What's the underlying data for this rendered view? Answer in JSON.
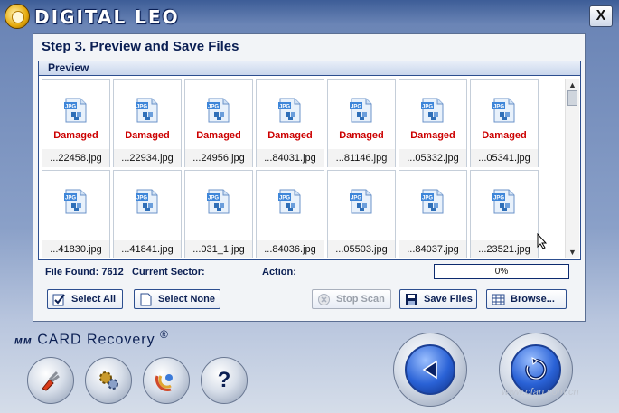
{
  "app": {
    "brand": "DIGITAL LEO",
    "close_label": "X"
  },
  "dialog": {
    "step_title": "Step 3. Preview and Save Files",
    "preview_label": "Preview",
    "tiles": [
      {
        "status": "Damaged",
        "name": "...22458.jpg"
      },
      {
        "status": "Damaged",
        "name": "...22934.jpg"
      },
      {
        "status": "Damaged",
        "name": "...24956.jpg"
      },
      {
        "status": "Damaged",
        "name": "...84031.jpg"
      },
      {
        "status": "Damaged",
        "name": "...81146.jpg"
      },
      {
        "status": "Damaged",
        "name": "...05332.jpg"
      },
      {
        "status": "Damaged",
        "name": "...05341.jpg"
      },
      {
        "status": "",
        "name": "...41830.jpg"
      },
      {
        "status": "",
        "name": "...41841.jpg"
      },
      {
        "status": "",
        "name": "...031_1.jpg"
      },
      {
        "status": "",
        "name": "...84036.jpg"
      },
      {
        "status": "",
        "name": "...05503.jpg"
      },
      {
        "status": "",
        "name": "...84037.jpg"
      },
      {
        "status": "",
        "name": "...23521.jpg"
      }
    ],
    "file_icon_label": "JPG",
    "status": {
      "file_found_label": "File Found: 7612",
      "current_sector_label": "Current Sector:",
      "action_label": "Action:",
      "progress_text": "0%",
      "progress_value": 0
    },
    "buttons": {
      "select_all": "Select All",
      "select_none": "Select None",
      "stop_scan": "Stop Scan",
      "save_files": "Save Files",
      "browse": "Browse..."
    }
  },
  "footer": {
    "product_prefix": "мм",
    "product_name": "CARD Recovery",
    "registered": "®",
    "help_label": "?",
    "watermark": "www.cfan.com.cn"
  },
  "colors": {
    "accent": "#0b1f53",
    "damaged": "#cc0000",
    "border": "#2c4e8f"
  }
}
